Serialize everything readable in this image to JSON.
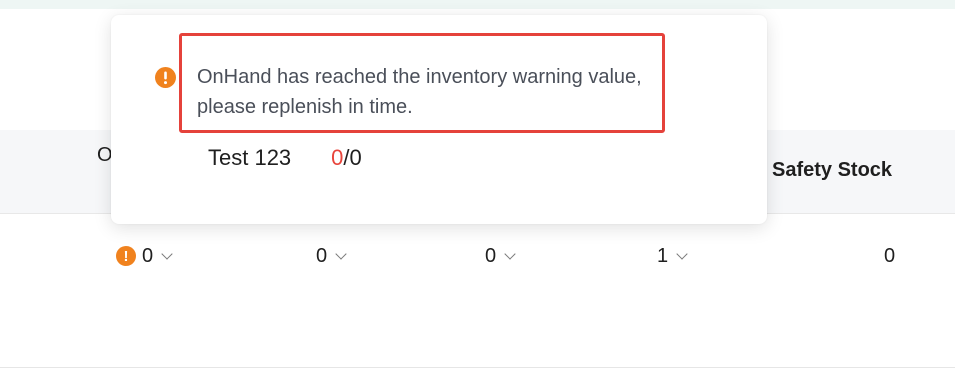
{
  "table": {
    "header_partial": "O",
    "safety_stock_label": "Safety Stock",
    "row": {
      "col1": "0",
      "col2": "0",
      "col3": "0",
      "col4": "1",
      "safety_stock": "0"
    }
  },
  "popover": {
    "message": "OnHand has reached the inventory warning value, please replenish in time.",
    "item_name": "Test 123",
    "current": "0",
    "separator": "/",
    "total": "0"
  },
  "colors": {
    "warning_icon": "#f0821e",
    "highlight_border": "#e5423b",
    "current_value": "#e8453c"
  },
  "icons": {
    "warning": "exclamation-circle-icon",
    "dropdown": "chevron-down-icon"
  }
}
